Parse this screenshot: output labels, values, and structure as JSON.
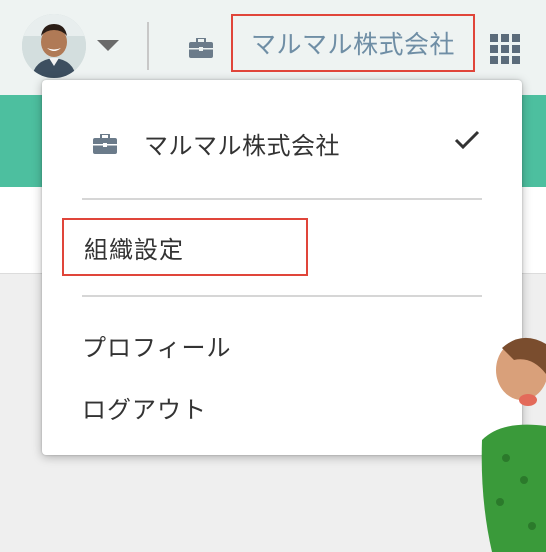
{
  "header": {
    "company_name": "マルマル株式会社",
    "avatar_icon": "user-avatar",
    "menu_caret_icon": "caret-down-icon",
    "company_icon": "briefcase-icon",
    "apps_icon": "grid-apps-icon"
  },
  "dropdown": {
    "current_company": {
      "label": "マルマル株式会社",
      "icon": "briefcase-icon",
      "selected_icon": "checkmark-icon"
    },
    "org_settings_label": "組織設定",
    "profile_label": "プロフィール",
    "logout_label": "ログアウト"
  },
  "colors": {
    "accent_teal": "#4dbf9f",
    "highlight_red": "#e0453a",
    "company_link": "#6f8ea5"
  }
}
